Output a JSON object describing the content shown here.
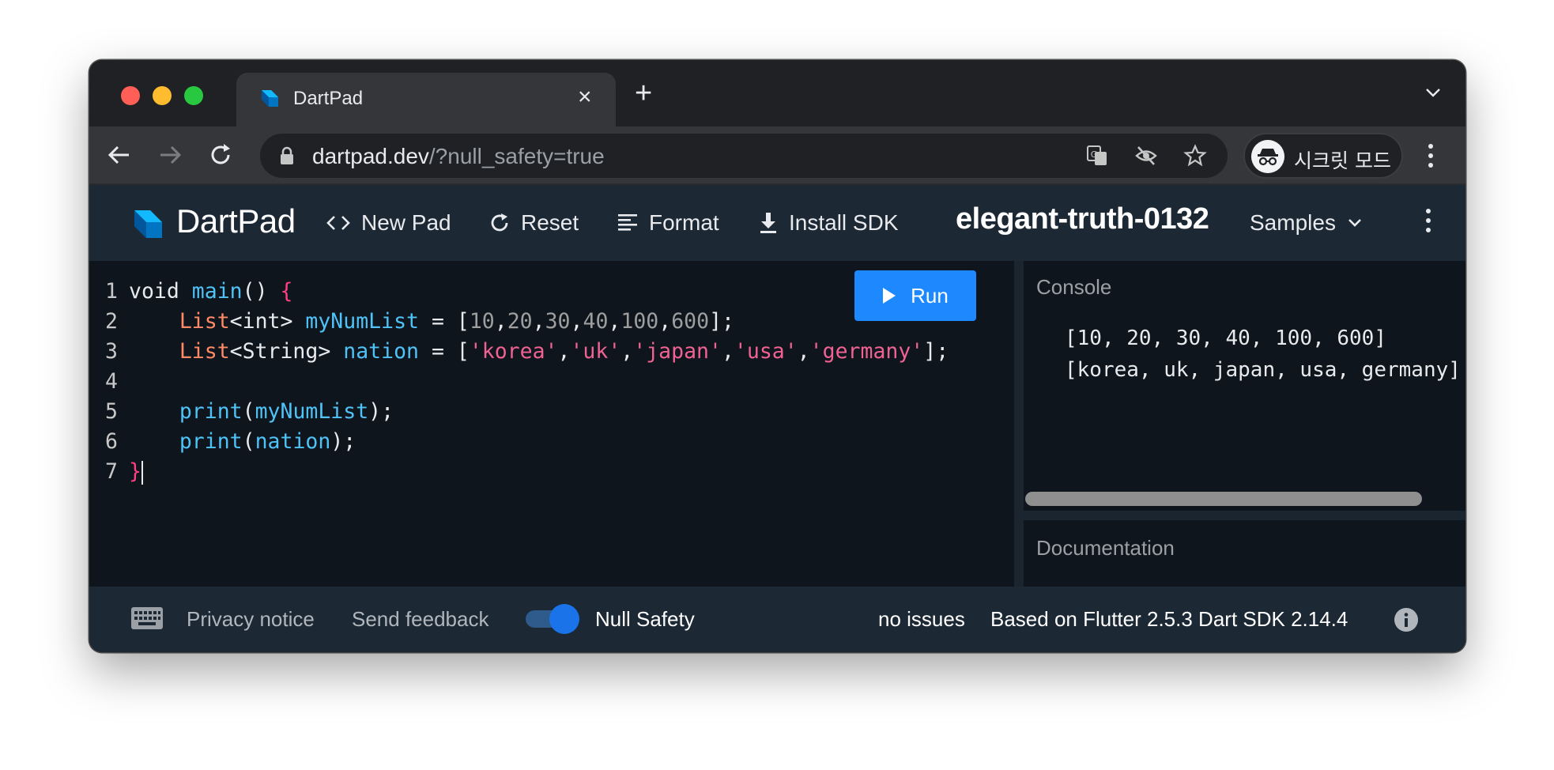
{
  "browser": {
    "tab_title": "DartPad",
    "tab_close": "×",
    "new_tab": "+",
    "url_host": "dartpad.dev",
    "url_path": "/?null_safety=true",
    "incognito_label": "시크릿 모드"
  },
  "header": {
    "title": "DartPad",
    "new_pad": "New Pad",
    "reset": "Reset",
    "format": "Format",
    "install_sdk": "Install SDK",
    "pad_name": "elegant-truth-0132",
    "samples": "Samples"
  },
  "editor": {
    "run_label": "Run",
    "line_numbers": [
      "1",
      "2",
      "3",
      "4",
      "5",
      "6",
      "7"
    ],
    "lines": {
      "l1": {
        "kw": "void ",
        "fn": "main",
        "rest": "() ",
        "brace": "{"
      },
      "l2": {
        "indent": "    ",
        "type": "List",
        "generic": "<int> ",
        "var": "myNumList",
        "eq": " = [",
        "nums": [
          "10",
          "20",
          "30",
          "40",
          "100",
          "600"
        ],
        "sep": ",",
        "end": "];"
      },
      "l3": {
        "indent": "    ",
        "type": "List",
        "generic": "<String> ",
        "var": "nation",
        "eq": " = [",
        "strs": [
          "'korea'",
          "'uk'",
          "'japan'",
          "'usa'",
          "'germany'"
        ],
        "sep": ",",
        "end": "];"
      },
      "l5": {
        "indent": "    ",
        "fn": "print",
        "open": "(",
        "arg": "myNumList",
        "close": ");"
      },
      "l6": {
        "indent": "    ",
        "fn": "print",
        "open": "(",
        "arg": "nation",
        "close": ");"
      },
      "l7": {
        "brace": "}"
      }
    }
  },
  "console": {
    "label": "Console",
    "output": [
      "[10, 20, 30, 40, 100, 600]",
      "[korea, uk, japan, usa, germany]"
    ]
  },
  "docs": {
    "label": "Documentation"
  },
  "footer": {
    "privacy": "Privacy notice",
    "feedback": "Send feedback",
    "null_safety": "Null Safety",
    "null_safety_on": true,
    "issues": "no issues",
    "version": "Based on Flutter 2.5.3 Dart SDK 2.14.4"
  },
  "colors": {
    "accent": "#1e88ff",
    "header_bg": "#1c2834",
    "editor_bg": "#0e151d",
    "function": "#4fc3f7",
    "type": "#ff8a65",
    "string": "#f06292"
  }
}
